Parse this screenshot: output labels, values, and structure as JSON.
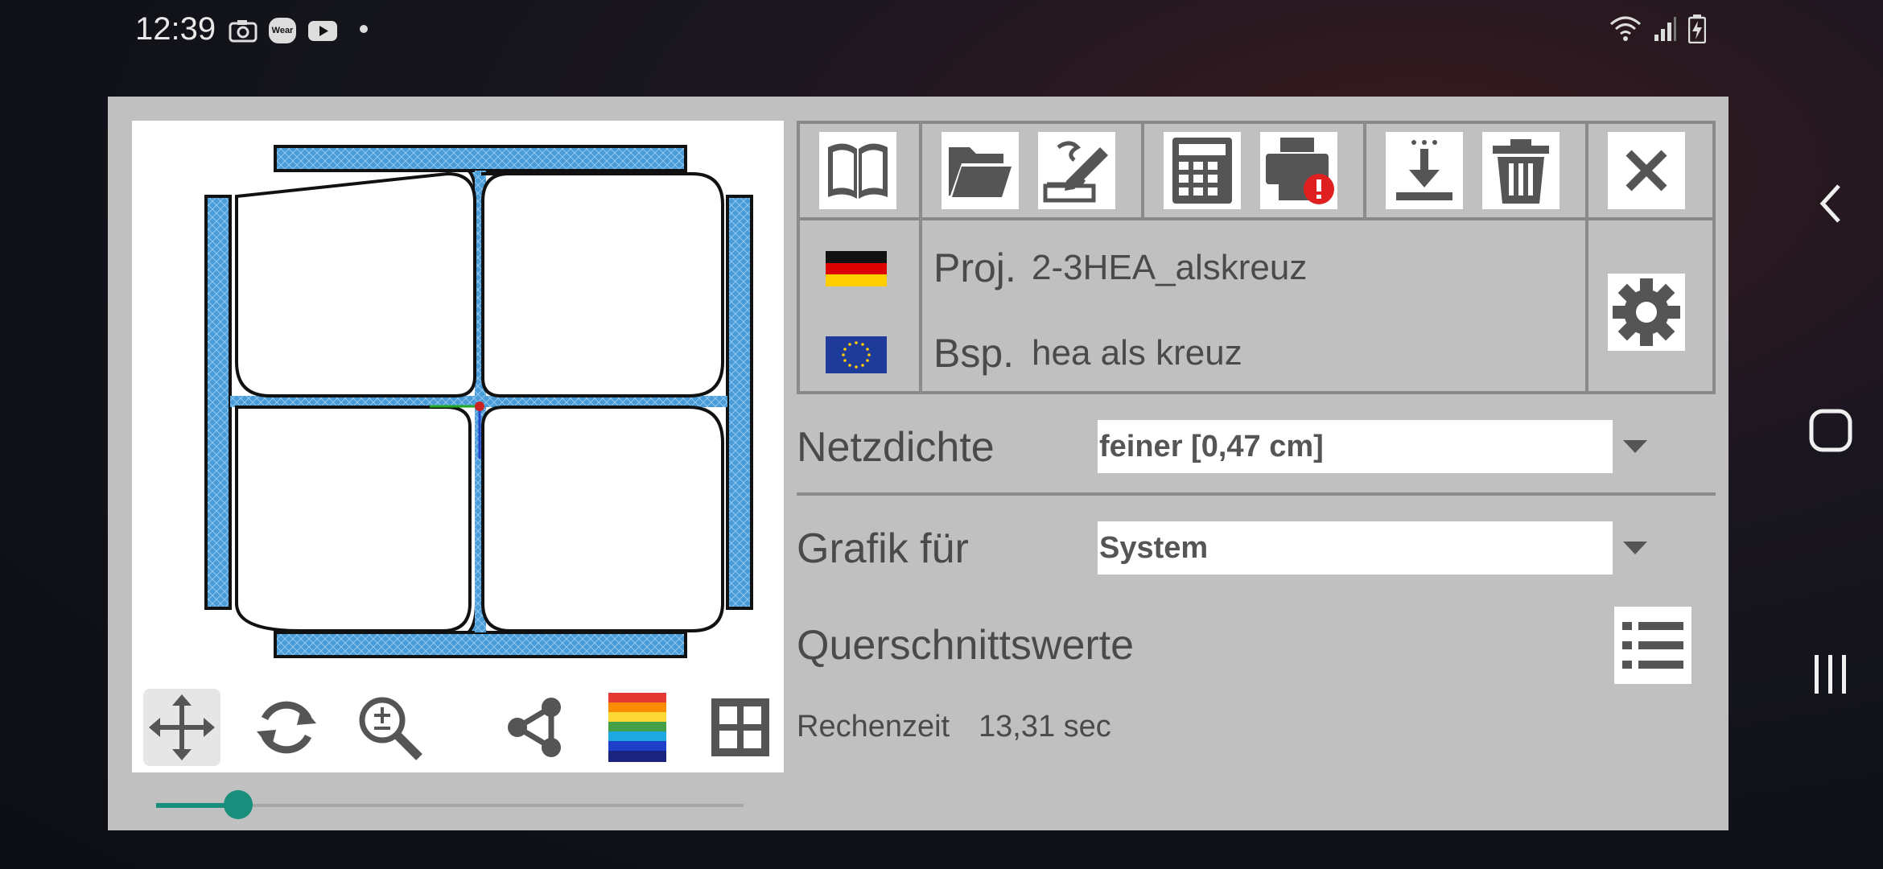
{
  "status_bar": {
    "time": "12:39",
    "notification_icons": [
      "camera-icon",
      "wear-icon",
      "youtube-icon",
      "dot-icon"
    ],
    "wear_label": "Wear",
    "system_icons": [
      "wifi-icon",
      "signal-icon",
      "battery-charging-icon"
    ]
  },
  "nav_bar": [
    "back-icon",
    "home-icon",
    "recents-icon"
  ],
  "toolbar": {
    "icons": [
      "book-icon",
      "folder-icon",
      "edit-icon",
      "calculator-icon",
      "print-warning-icon",
      "download-icon",
      "trash-icon",
      "close-icon",
      "settings-icon"
    ]
  },
  "project": {
    "proj_label": "Proj.",
    "proj_value": "2-3HEA_alskreuz",
    "bsp_label": "Bsp.",
    "bsp_value": "hea als kreuz",
    "flags": [
      "germany-flag",
      "eu-flag"
    ]
  },
  "form": {
    "netzdichte_label": "Netzdichte",
    "netzdichte_value": "feiner [0,47 cm]",
    "grafik_label": "Grafik für",
    "grafik_value": "System",
    "querschnitt_label": "Querschnittswerte"
  },
  "footer": {
    "rechenzeit_label": "Rechenzeit",
    "rechenzeit_value": "13,31 sec"
  },
  "canvas_tools": [
    "move-icon",
    "refresh-icon",
    "zoom-icon",
    "share-icon",
    "color-scale-icon",
    "grid-icon"
  ],
  "slider": {
    "value": 0.14
  },
  "colors": {
    "dialog_bg": "#c0c0c0",
    "accent": "#188f7c",
    "mesh_fill": "#4a9cd8",
    "outline": "#111111"
  }
}
